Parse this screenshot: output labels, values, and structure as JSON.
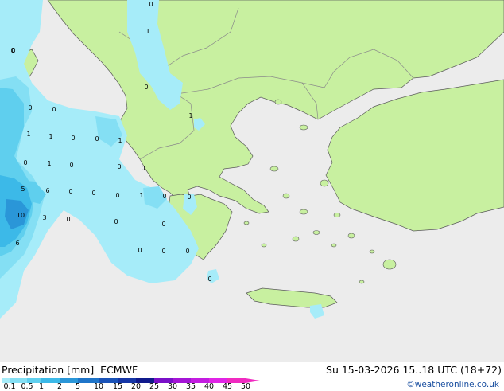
{
  "footer": {
    "title": "Precipitation [mm]",
    "model": "ECMWF",
    "datetime": "Su 15-03-2026 15..18 UTC (18+72)",
    "copyright": "©weatheronline.co.uk"
  },
  "legend": {
    "ticks": [
      "0.1",
      "0.5",
      "1",
      "2",
      "5",
      "10",
      "15",
      "20",
      "25",
      "30",
      "35",
      "40",
      "45",
      "50"
    ],
    "colors": [
      "#a6ecf9",
      "#84dff4",
      "#5fcfee",
      "#3cb9e8",
      "#2a96d8",
      "#1f75c9",
      "#1a53b8",
      "#1636a6",
      "#101a8c",
      "#7a10c8",
      "#a415d6",
      "#c31ce0",
      "#e024e6",
      "#f02ac0"
    ]
  },
  "map": {
    "colors": {
      "sea": "#ececec",
      "land": "#c8f0a0",
      "border": "#8a8a8a",
      "coast": "#5a5a5a"
    },
    "point_values": [
      {
        "label": "0"
      },
      {
        "label": "1"
      },
      {
        "label": "0"
      },
      {
        "label": "0"
      },
      {
        "label": "1"
      },
      {
        "label": "0"
      },
      {
        "label": "1"
      },
      {
        "label": "1"
      },
      {
        "label": "0"
      },
      {
        "label": "0"
      },
      {
        "label": "1"
      },
      {
        "label": "0"
      },
      {
        "label": "0"
      },
      {
        "label": "1"
      },
      {
        "label": "0"
      },
      {
        "label": "0"
      },
      {
        "label": "0"
      },
      {
        "label": "5"
      },
      {
        "label": "6"
      },
      {
        "label": "0"
      },
      {
        "label": "0"
      },
      {
        "label": "0"
      },
      {
        "label": "1"
      },
      {
        "label": "0"
      },
      {
        "label": "0"
      },
      {
        "label": "10"
      },
      {
        "label": "3"
      },
      {
        "label": "0"
      },
      {
        "label": "6"
      },
      {
        "label": "0"
      },
      {
        "label": "0"
      },
      {
        "label": "0"
      },
      {
        "label": "0"
      },
      {
        "label": "0"
      },
      {
        "label": "0"
      },
      {
        "label": "0"
      }
    ]
  }
}
